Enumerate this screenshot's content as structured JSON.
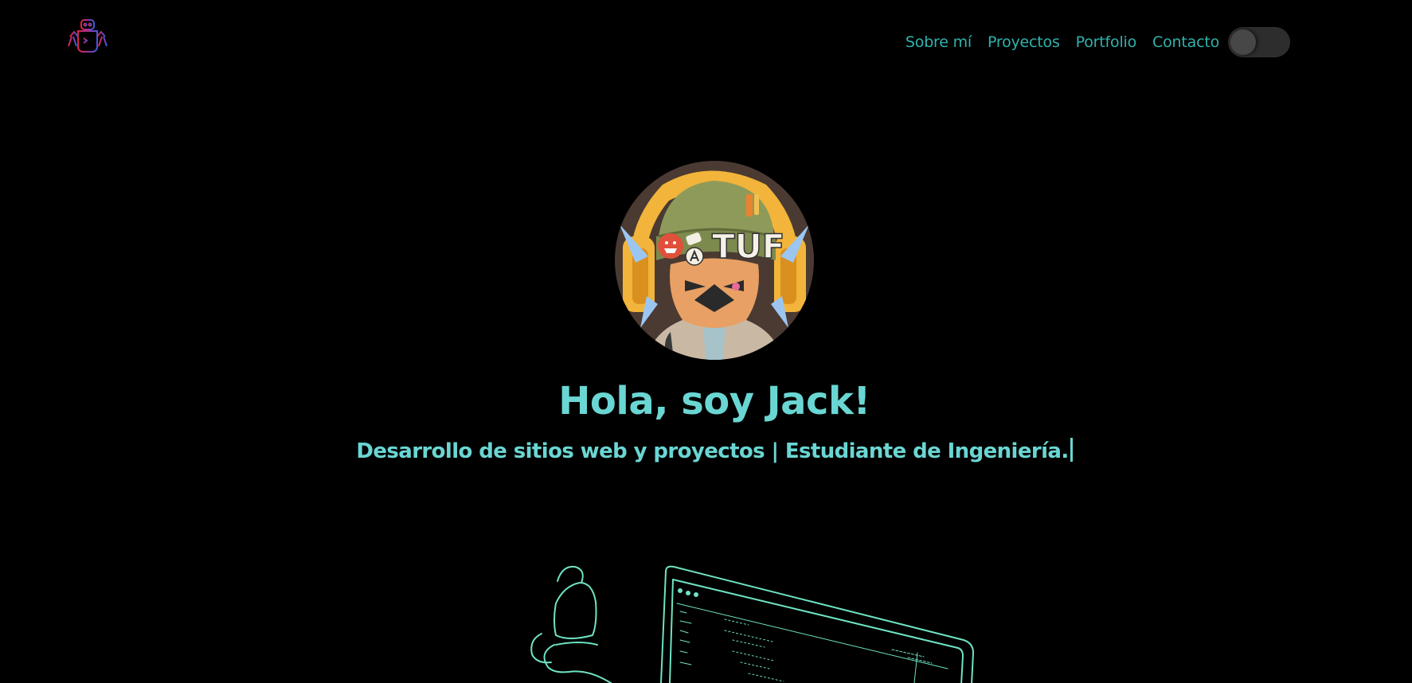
{
  "nav": {
    "links": [
      "Sobre mí",
      "Proyectos",
      "Portfolio",
      "Contacto"
    ]
  },
  "theme_toggle": {
    "state": "off"
  },
  "hero": {
    "title": "Hola, soy Jack!",
    "subtitle": "Desarrollo de sitios web y proyectos | Estudiante de Ingeniería."
  },
  "avatar_text": "TUF",
  "colors": {
    "background": "#000000",
    "nav_link": "#30b2ad",
    "hero_text": "#6ad6d3",
    "illustration_line": "#6fe3c4",
    "toggle_track": "#2d2d2d",
    "toggle_knob": "#474747"
  },
  "icons": {
    "logo": "robot-icon",
    "toggle": "theme-toggle"
  }
}
